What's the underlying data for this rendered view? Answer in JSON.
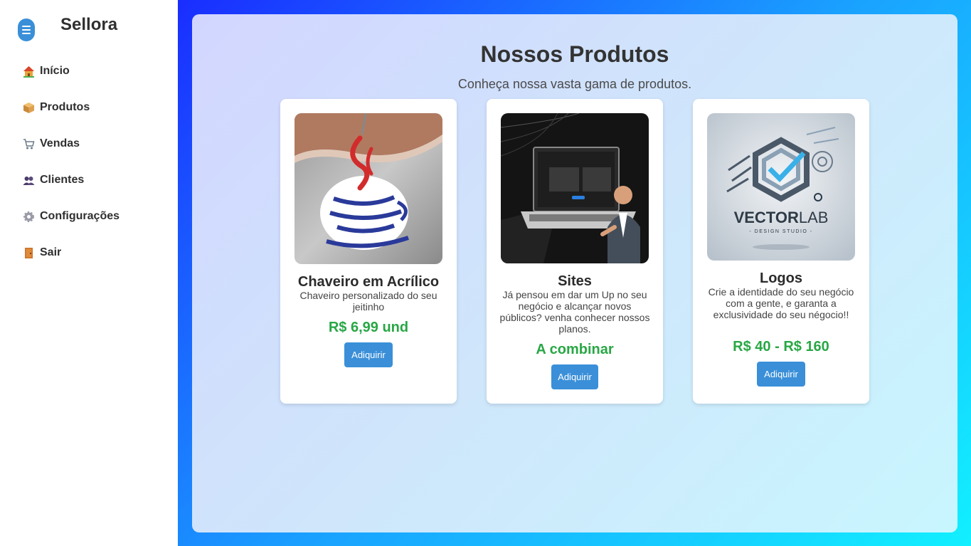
{
  "app": {
    "brand": "Sellora"
  },
  "sidebar": {
    "items": [
      {
        "label": "Início",
        "icon": "house-icon"
      },
      {
        "label": "Produtos",
        "icon": "package-icon"
      },
      {
        "label": "Vendas",
        "icon": "cart-icon"
      },
      {
        "label": "Clientes",
        "icon": "users-icon"
      },
      {
        "label": "Configurações",
        "icon": "gear-icon"
      },
      {
        "label": "Sair",
        "icon": "door-icon"
      }
    ]
  },
  "main": {
    "title": "Nossos Produtos",
    "subtitle": "Conheça nossa vasta gama de produtos.",
    "products": [
      {
        "name": "Chaveiro em Acrílico",
        "description": "Chaveiro personalizado do seu jeitinho",
        "price": "R$ 6,99 und",
        "button": "Adiquirir"
      },
      {
        "name": "Sites",
        "description": "Já pensou em dar um Up no seu negócio e alcançar novos públicos? venha conhecer nossos planos.",
        "price": "A combinar",
        "button": "Adiquirir"
      },
      {
        "name": "Logos",
        "description": "Crie a identidade do seu negócio com a gente, e garanta a exclusividade do seu négocio!!",
        "price": "R$ 40 - R$ 160",
        "button": "Adiquirir",
        "image_text": {
          "brand": "VECTORLAB",
          "tagline": "DESIGN STUDIO"
        }
      }
    ]
  },
  "colors": {
    "accent": "#3a8fd8",
    "price": "#28a745"
  }
}
